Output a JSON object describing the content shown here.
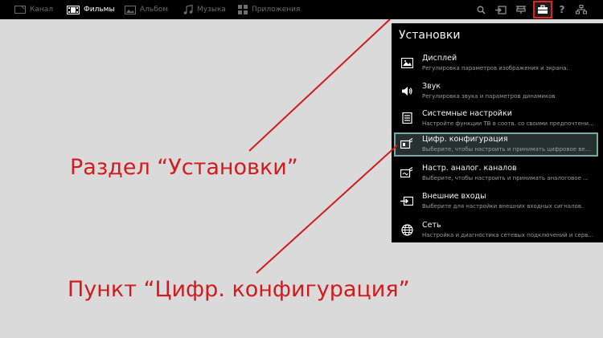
{
  "top_nav": {
    "items": [
      {
        "label": "Канал",
        "icon": "tv-icon"
      },
      {
        "label": "Фильмы",
        "icon": "film-icon",
        "active": true
      },
      {
        "label": "Альбом",
        "icon": "photo-icon"
      },
      {
        "label": "Музыка",
        "icon": "music-icon"
      },
      {
        "label": "Приложения",
        "icon": "apps-icon"
      }
    ],
    "right_icons": [
      "search-icon",
      "input-icon",
      "antenna-icon",
      "toolbox-icon",
      "help-icon",
      "network-icon"
    ],
    "help_glyph": "?"
  },
  "settings_panel": {
    "title": "Установки",
    "items": [
      {
        "title": "Дисплей",
        "description": "Регулировка параметров изображения и экрана.",
        "icon": "picture-icon"
      },
      {
        "title": "Звук",
        "description": "Регулировка звука и параметров динамиков",
        "icon": "speaker-icon"
      },
      {
        "title": "Системные настройки",
        "description": "Настройте функции ТВ в соотв. со своими предпочтени...",
        "icon": "system-list-icon"
      },
      {
        "title": "Цифр. конфигурация",
        "description": "Выберите, чтобы настроить и принимать цифровое ве...",
        "icon": "digital-antenna-icon",
        "highlighted": true
      },
      {
        "title": "Настр. аналог. каналов",
        "description": "Выберите, чтобы настроить и принимать аналоговое ...",
        "icon": "analog-antenna-icon"
      },
      {
        "title": "Внешние входы",
        "description": "Выберите для настройки внешних входных сигналов.",
        "icon": "input-arrow-icon"
      },
      {
        "title": "Сеть",
        "description": "Настройка и диагностика сетевых подключений и серв...",
        "icon": "globe-icon"
      }
    ]
  },
  "annotations": {
    "section_label": "Раздел “Установки”",
    "item_label": "Пункт “Цифр. конфигурация”"
  },
  "colors": {
    "annotation_red": "#d11b1e",
    "highlight_border": "#78a8a5",
    "selected_outline": "#e31e24",
    "background": "#dadada"
  }
}
